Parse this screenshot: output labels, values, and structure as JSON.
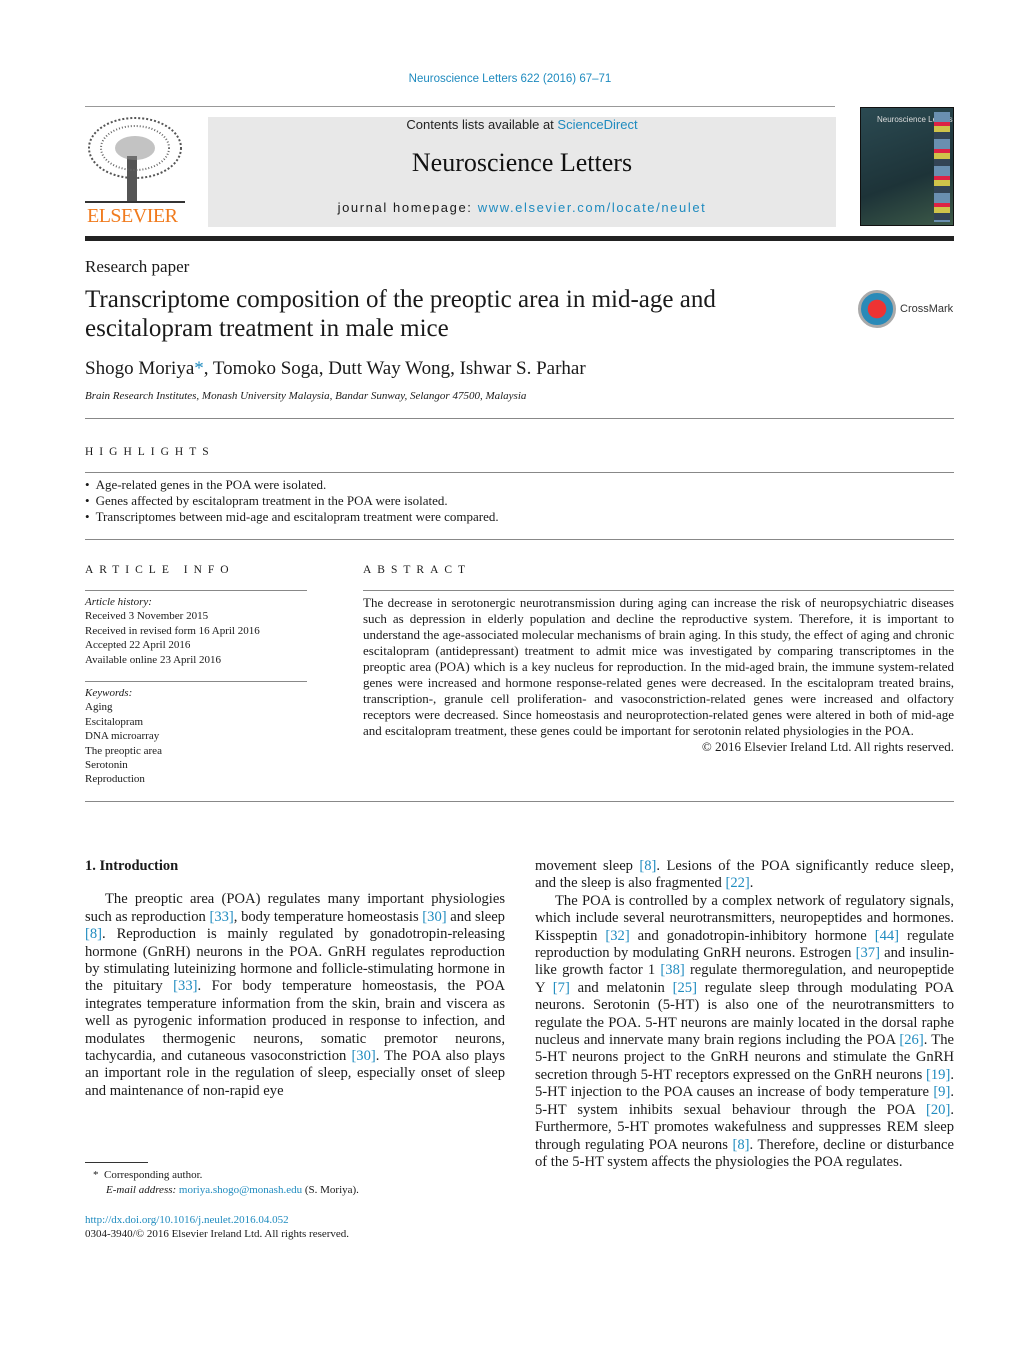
{
  "header": {
    "citation": "Neuroscience Letters 622 (2016) 67–71",
    "contents_prefix": "Contents lists available at ",
    "sciencedirect": "ScienceDirect",
    "journal_title": "Neuroscience Letters",
    "homepage_prefix": "journal homepage: ",
    "homepage_url": "www.elsevier.com/locate/neulet",
    "publisher_logo": "ELSEVIER",
    "cover_title": "Neuroscience Letters",
    "crossmark": "CrossMark"
  },
  "article": {
    "type": "Research paper",
    "title": "Transcriptome composition of the preoptic area in mid-age and escitalopram treatment in male mice",
    "authors": [
      {
        "name": "Shogo Moriya",
        "mark": "*"
      },
      {
        "name": ", Tomoko Soga, Dutt Way Wong, Ishwar S. Parhar"
      }
    ],
    "affiliation": "Brain Research Institutes, Monash University Malaysia, Bandar Sunway, Selangor 47500, Malaysia"
  },
  "highlights": {
    "heading": "HIGHLIGHTS",
    "items": [
      "Age-related genes in the POA were isolated.",
      "Genes affected by escitalopram treatment in the POA were isolated.",
      "Transcriptomes between mid-age and escitalopram treatment were compared."
    ]
  },
  "article_info": {
    "heading": "ARTICLE INFO",
    "history_label": "Article history:",
    "history": [
      "Received 3 November 2015",
      "Received in revised form 16 April 2016",
      "Accepted 22 April 2016",
      "Available online 23 April 2016"
    ],
    "keywords_label": "Keywords:",
    "keywords": [
      "Aging",
      "Escitalopram",
      "DNA microarray",
      "The preoptic area",
      "Serotonin",
      "Reproduction"
    ]
  },
  "abstract": {
    "heading": "ABSTRACT",
    "text": "The decrease in serotonergic neurotransmission during aging can increase the risk of neuropsychiatric diseases such as depression in elderly population and decline the reproductive system. Therefore, it is important to understand the age-associated molecular mechanisms of brain aging. In this study, the effect of aging and chronic escitalopram (antidepressant) treatment to admit mice was investigated by comparing transcriptomes in the preoptic area (POA) which is a key nucleus for reproduction. In the mid-aged brain, the immune system-related genes were increased and hormone response-related genes were decreased. In the escitalopram treated brains, transcription-, granule cell proliferation- and vasoconstriction-related genes were increased and olfactory receptors were decreased. Since homeostasis and neuroprotection-related genes were altered in both of mid-age and escitalopram treatment, these genes could be important for serotonin related physiologies in the POA.",
    "copyright": "© 2016 Elsevier Ireland Ltd. All rights reserved."
  },
  "body": {
    "section_title": "1.  Introduction",
    "left_paragraphs": [
      [
        {
          "t": "The preoptic area (POA) regulates many important physiologies such as reproduction "
        },
        {
          "c": "[33]"
        },
        {
          "t": ", body temperature homeostasis "
        },
        {
          "c": "[30]"
        },
        {
          "t": " and sleep "
        },
        {
          "c": "[8]"
        },
        {
          "t": ". Reproduction is mainly regulated by gonadotropin-releasing hormone (GnRH) neurons in the POA. GnRH regulates reproduction by stimulating luteinizing hormone and follicle-stimulating hormone in the pituitary "
        },
        {
          "c": "[33]"
        },
        {
          "t": ". For body temperature homeostasis, the POA integrates temperature information from the skin, brain and viscera as well as pyrogenic information produced in response to infection, and modulates thermogenic neurons, somatic premotor neurons, tachycardia, and cutaneous vasoconstriction "
        },
        {
          "c": "[30]"
        },
        {
          "t": ". The POA also plays an important role in the regulation of sleep, especially onset of sleep and maintenance of non-rapid eye"
        }
      ]
    ],
    "right_paragraphs": [
      [
        {
          "t": "movement sleep "
        },
        {
          "c": "[8]"
        },
        {
          "t": ". Lesions of the POA significantly reduce sleep, and the sleep is also fragmented "
        },
        {
          "c": "[22]"
        },
        {
          "t": "."
        }
      ],
      [
        {
          "t": "The POA is controlled by a complex network of regulatory signals, which include several neurotransmitters, neuropeptides and hormones. Kisspeptin "
        },
        {
          "c": "[32]"
        },
        {
          "t": " and gonadotropin-inhibitory hormone "
        },
        {
          "c": "[44]"
        },
        {
          "t": " regulate reproduction by modulating GnRH neurons. Estrogen "
        },
        {
          "c": "[37]"
        },
        {
          "t": " and insulin-like growth factor 1 "
        },
        {
          "c": "[38]"
        },
        {
          "t": " regulate thermoregulation, and neuropeptide Y "
        },
        {
          "c": "[7]"
        },
        {
          "t": " and melatonin "
        },
        {
          "c": "[25]"
        },
        {
          "t": " regulate sleep through modulating POA neurons. Serotonin (5-HT) is also one of the neurotransmitters to regulate the POA. 5-HT neurons are mainly located in the dorsal raphe nucleus and innervate many brain regions including the POA "
        },
        {
          "c": "[26]"
        },
        {
          "t": ". The 5-HT neurons project to the GnRH neurons and stimulate the GnRH secretion through 5-HT receptors expressed on the GnRH neurons "
        },
        {
          "c": "[19]"
        },
        {
          "t": ". 5-HT injection to the POA causes an increase of body temperature "
        },
        {
          "c": "[9]"
        },
        {
          "t": ". 5-HT system inhibits sexual behaviour through the POA "
        },
        {
          "c": "[20]"
        },
        {
          "t": ". Furthermore, 5-HT promotes wakefulness and suppresses REM sleep through regulating POA neurons "
        },
        {
          "c": "[8]"
        },
        {
          "t": ". Therefore, decline or disturbance of the 5-HT system affects the physiologies the POA regulates."
        }
      ]
    ]
  },
  "footnote": {
    "mark": "*",
    "corresponding": "Corresponding author.",
    "email_label": "E-mail address: ",
    "email": "moriya.shogo@monash.edu",
    "email_suffix": " (S. Moriya).",
    "doi": "http://dx.doi.org/10.1016/j.neulet.2016.04.052",
    "issn_line": "0304-3940/© 2016 Elsevier Ireland Ltd. All rights reserved."
  },
  "colors": {
    "link": "#1f8bbf",
    "elsevier_orange": "#f07b1e",
    "banner_bg": "#e8e8e8"
  }
}
